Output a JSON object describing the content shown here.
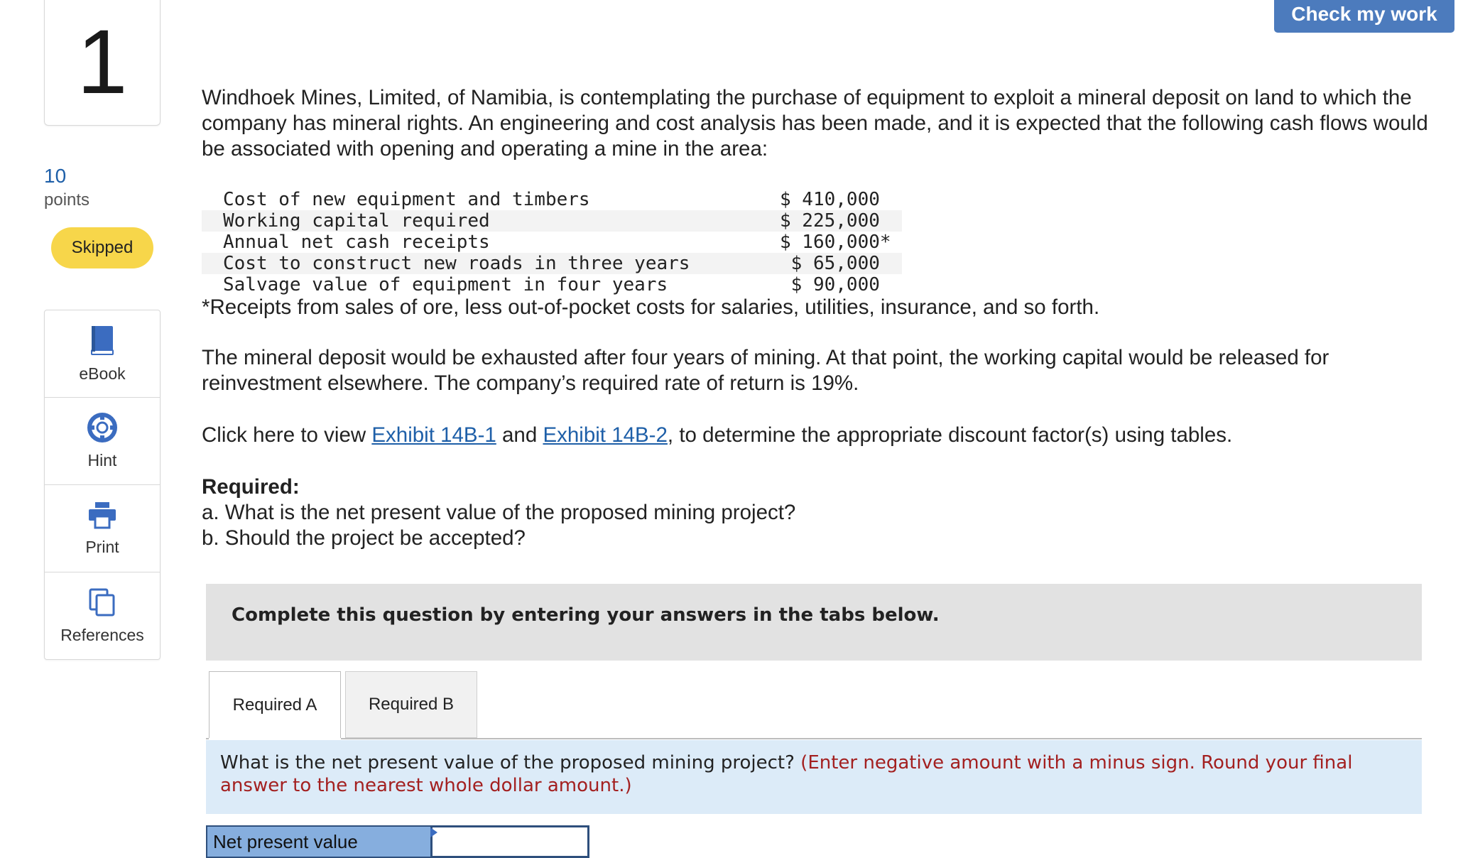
{
  "question": {
    "number": "1",
    "points_value": "10",
    "points_label": "points",
    "status": "Skipped"
  },
  "tools": [
    {
      "label": "eBook",
      "icon": "book-icon"
    },
    {
      "label": "Hint",
      "icon": "lifebuoy-icon"
    },
    {
      "label": "Print",
      "icon": "printer-icon"
    },
    {
      "label": "References",
      "icon": "copy-icon"
    }
  ],
  "header": {
    "check_label": "Check my work"
  },
  "body": {
    "intro": "Windhoek Mines, Limited, of Namibia, is contemplating the purchase of equipment to exploit a mineral deposit on land to which the company has mineral rights. An engineering and cost analysis has been made, and it is expected that the following cash flows would be associated with opening and operating a mine in the area:",
    "cash_flows": [
      {
        "item": "Cost of new equipment and timbers",
        "amount": "$ 410,000"
      },
      {
        "item": "Working capital required",
        "amount": "$ 225,000"
      },
      {
        "item": "Annual net cash receipts",
        "amount": "$ 160,000*"
      },
      {
        "item": "Cost to construct new roads in three years",
        "amount": " $ 65,000"
      },
      {
        "item": "Salvage value of equipment in four years",
        "amount": " $ 90,000"
      }
    ],
    "footnote": "*Receipts from sales of ore, less out-of-pocket costs for salaries, utilities, insurance, and so forth.",
    "para2": "The mineral deposit would be exhausted after four years of mining. At that point, the working capital would be released for reinvestment elsewhere. The company’s required rate of return is 19%.",
    "para3_pre": "Click here to view ",
    "link1": "Exhibit 14B-1",
    "para3_mid": " and ",
    "link2": "Exhibit 14B-2",
    "para3_post": ", to determine the appropriate discount factor(s) using tables.",
    "required_title": "Required:",
    "required_a": "a. What is the net present value of the proposed mining project?",
    "required_b": "b. Should the project be accepted?"
  },
  "instruction": "Complete this question by entering your answers in the tabs below.",
  "tabs": [
    {
      "label": "Required A"
    },
    {
      "label": "Required B"
    }
  ],
  "panel": {
    "question": "What is the net present value of the proposed mining project? ",
    "note": "(Enter negative amount with a minus sign. Round your final answer to the nearest whole dollar amount.)"
  },
  "answer": {
    "label": "Net present value",
    "value": ""
  },
  "colors": {
    "accent": "#4c7bbd",
    "link": "#1e5fa8",
    "badge": "#f7d64a",
    "panel": "#dcebf8",
    "note": "#a32020"
  }
}
